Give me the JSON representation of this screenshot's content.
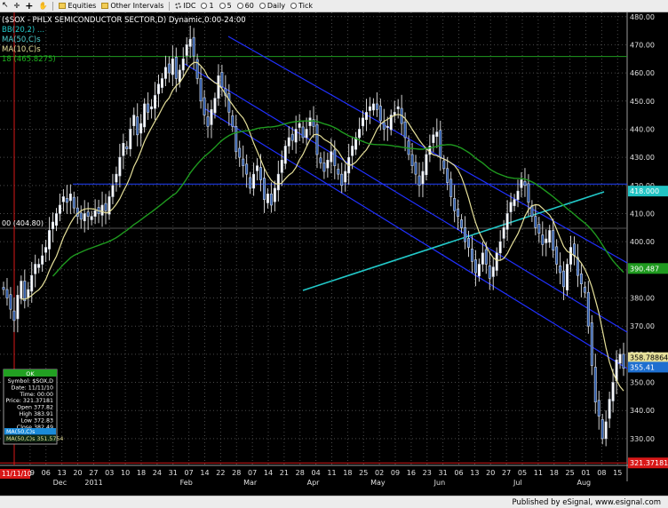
{
  "toolbar": {
    "items": [
      {
        "label": "",
        "icon": "arrow-icon"
      },
      {
        "label": "",
        "icon": "crosshair-icon"
      },
      {
        "label": "",
        "icon": "plus-icon"
      },
      {
        "label": "",
        "icon": "hand-icon"
      },
      {
        "label": "Equities",
        "icon": "folder-icon"
      },
      {
        "label": "Other Intervals",
        "icon": "folder-icon"
      },
      {
        "label": "IDC",
        "icon": "gear-icon"
      },
      {
        "label": "1",
        "icon": "clock-icon"
      },
      {
        "label": "5",
        "icon": "clock-icon"
      },
      {
        "label": "60",
        "icon": "clock-icon"
      },
      {
        "label": "Daily",
        "icon": "clock-icon"
      },
      {
        "label": "Tick",
        "icon": "clock-icon"
      }
    ]
  },
  "chart_title": "($SOX - PHLX SEMICONDUCTOR SECTOR,D) Dynamic,0:00-24:00",
  "legend_lines": [
    {
      "text": "BB(20,2) ...",
      "color": "#22c8c8"
    },
    {
      "text": "MA(50,C)s",
      "color": "#4fd0d0"
    },
    {
      "text": "MA(10,C)s",
      "color": "#e6e09a"
    },
    {
      "text": "18 (465.8275)",
      "color": "#20b020"
    }
  ],
  "hline_labels": {
    "level_404": "00 (404.80)"
  },
  "price_tags": [
    {
      "text": "418.000",
      "bg": "#22c4c4",
      "fg": "#ffffff"
    },
    {
      "text": "390.487",
      "bg": "#1f9a1f",
      "fg": "#ffffff"
    },
    {
      "text": "358.788648",
      "bg": "#e6e09a",
      "fg": "#000000"
    },
    {
      "text": "355.41",
      "bg": "#1e6fd0",
      "fg": "#ffffff"
    },
    {
      "text": "321.37181",
      "bg": "#d81818",
      "fg": "#ffffff"
    }
  ],
  "cursor_date_tag": "11/11/10",
  "data_window": {
    "header": "OK",
    "rows": [
      "Symbol: $SOX,D",
      "Date: 11/11/10",
      "Time: 00:00",
      "Price: 321.37181",
      "Open 377.82",
      "High 383.91",
      "Low 372.83",
      "Close 382.49"
    ],
    "indicators": [
      {
        "text": "MA(50,C)s",
        "color": "#4fd0d0"
      },
      {
        "text": "MA(50,C)s 351.5754",
        "color": "#e6e09a"
      }
    ]
  },
  "footer_text": "Published by eSignal, www.esignal.com",
  "chart_data": {
    "type": "candlestick",
    "title": "($SOX - PHLX SEMICONDUCTOR SECTOR,D) Dynamic,0:00-24:00",
    "y_ticks": [
      330,
      340,
      350,
      360,
      370,
      380,
      390,
      400,
      410,
      420,
      430,
      440,
      450,
      460,
      470,
      480
    ],
    "ylim": [
      320.5,
      481.5
    ],
    "x_tick_labels": [
      "22",
      "29",
      "06",
      "13",
      "20",
      "27",
      "03",
      "10",
      "18",
      "24",
      "31",
      "07",
      "14",
      "22",
      "28",
      "07",
      "14",
      "21",
      "28",
      "04",
      "11",
      "18",
      "25",
      "02",
      "09",
      "16",
      "23",
      "31",
      "06",
      "13",
      "20",
      "27",
      "05",
      "11",
      "18",
      "25",
      "01",
      "08",
      "15"
    ],
    "x_month_labels": [
      "Dec",
      "2011",
      "Feb",
      "Mar",
      "Apr",
      "May",
      "Jun",
      "Jul",
      "Aug"
    ],
    "series": [
      {
        "name": "MA(10,C)s",
        "color": "#e6e09a"
      },
      {
        "name": "MA(50,C)s",
        "color": "#1f9a1f"
      }
    ],
    "closes": [
      383,
      380,
      376,
      372,
      381,
      386,
      379,
      383,
      388,
      392,
      392,
      395,
      398,
      404,
      407,
      410,
      413,
      416,
      414,
      417,
      412,
      409,
      408,
      410,
      409,
      409,
      411,
      410,
      413,
      411,
      416,
      420,
      424,
      430,
      435,
      433,
      440,
      445,
      438,
      442,
      449,
      446,
      448,
      452,
      456,
      458,
      462,
      460,
      465,
      458,
      461,
      465,
      470,
      472,
      466,
      458,
      450,
      445,
      441,
      447,
      451,
      459,
      455,
      452,
      446,
      441,
      432,
      430,
      427,
      424,
      419,
      424,
      427,
      422,
      415,
      417,
      413,
      419,
      424,
      429,
      434,
      437,
      436,
      440,
      442,
      437,
      440,
      444,
      441,
      431,
      428,
      425,
      429,
      432,
      427,
      424,
      420,
      425,
      430,
      434,
      437,
      440,
      444,
      446,
      448,
      449,
      447,
      443,
      440,
      441,
      445,
      446,
      448,
      442,
      437,
      431,
      427,
      424,
      420,
      425,
      431,
      434,
      438,
      439,
      430,
      426,
      421,
      416,
      411,
      409,
      405,
      400,
      398,
      393,
      389,
      392,
      396,
      392,
      387,
      391,
      396,
      400,
      405,
      410,
      414,
      415,
      418,
      422,
      420,
      414,
      409,
      405,
      403,
      399,
      401,
      404,
      397,
      392,
      389,
      384,
      392,
      398,
      395,
      388,
      385,
      382,
      370,
      356,
      343,
      338,
      330,
      336,
      344,
      350,
      358,
      360,
      355
    ],
    "levels": {
      "upper_green": 465.83,
      "lower_black": 404.8,
      "blue_horizontal": 420.5,
      "cursor_price": 321.37
    }
  }
}
